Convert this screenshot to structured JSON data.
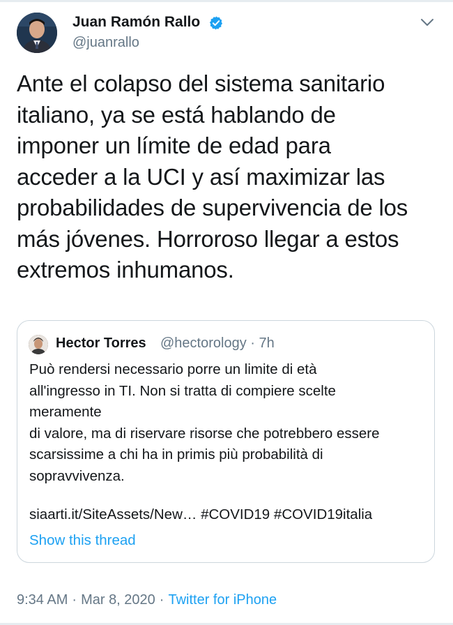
{
  "author": {
    "name": "Juan Ramón Rallo",
    "handle": "@juanrallo",
    "verified_icon": "verified-badge-icon"
  },
  "tweet": {
    "lines": [
      "Ante el colapso del sistema sanitario",
      "italiano, ya se está hablando de",
      "imponer un límite de edad para",
      "acceder a la UCI y así maximizar las",
      "probabilidades de supervivencia de los",
      "más jóvenes. Horroroso llegar a estos",
      "extremos inhumanos."
    ]
  },
  "quoted_tweet": {
    "name": "Hector Torres",
    "handle_time": "@hectorology · 7h",
    "lines": [
      "Può rendersi necessario porre un limite di età",
      "all'ingresso in TI. Non si tratta di compiere scelte",
      "meramente",
      "di valore, ma di riservare risorse che potrebbero essere",
      "scarsissime a chi ha in primis più probabilità di",
      "sopravvivenza."
    ],
    "link": "siaarti.it/SiteAssets/New…",
    "hashtag_1": "#COVID19",
    "hashtag_2": "#COVID19italia",
    "show_thread": "Show this thread"
  },
  "meta": {
    "time": "9:34 AM",
    "separator": "·",
    "date": "Mar 8, 2020",
    "source": "Twitter for iPhone"
  },
  "colors": {
    "accent": "#1da1f2",
    "secondary_text": "#657786",
    "border": "#ccd6dd"
  }
}
